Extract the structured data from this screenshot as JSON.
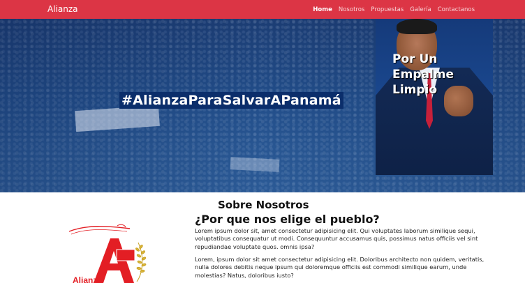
{
  "navbar": {
    "brand": "Alianza",
    "links": [
      {
        "label": "Home",
        "active": true
      },
      {
        "label": "Nosotros",
        "active": false
      },
      {
        "label": "Propuestas",
        "active": false
      },
      {
        "label": "Galería",
        "active": false
      },
      {
        "label": "Contactanos",
        "active": false
      }
    ],
    "color": "#dc3545"
  },
  "hero": {
    "hashtag": "#AlianzaParaSalvarAPanamá",
    "slogan": [
      "Por Un",
      "Empalme",
      "Limpio"
    ]
  },
  "about": {
    "title": "Sobre Nosotros",
    "subtitle": "¿Por que nos elige el pueblo?",
    "paragraphs": [
      "Lorem ipsum dolor sit, amet consectetur adipisicing elit. Qui voluptates laborum similique sequi, voluptatibus consequatur ut modi. Consequuntur accusamus quis, possimus natus officiis vel sint repudiandae voluptate quos. omnis ipsa?",
      "Lorem, ipsum dolor sit amet consectetur adipisicing elit. Doloribus architecto non quidem, veritatis, nulla dolores debitis neque ipsum qui doloremque officiis est commodi similique earum, unde molestias? Natus, doloribus iusto?"
    ]
  },
  "logo": {
    "letter": "A",
    "text": "Alianza",
    "colors": {
      "red": "#e31e24",
      "gold": "#c9a227"
    }
  }
}
